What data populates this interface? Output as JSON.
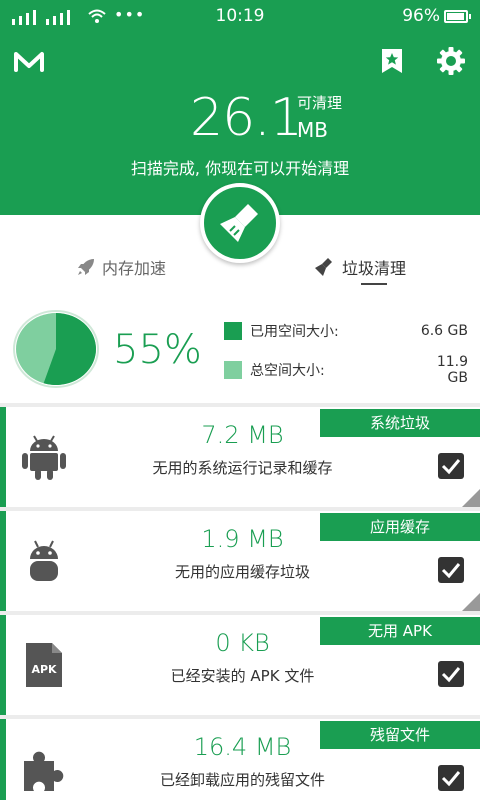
{
  "status_bar": {
    "time": "10:19",
    "battery": "96%",
    "dots": "•••"
  },
  "header": {
    "clean_size_value": "26.1",
    "clean_size_caption": "可清理",
    "clean_size_unit": "MB",
    "scan_message": "扫描完成, 你现在可以开始清理"
  },
  "tabs": [
    {
      "label": "内存加速",
      "icon": "rocket-icon",
      "selected": false
    },
    {
      "label": "垃圾清理",
      "icon": "broom-icon",
      "selected": true
    }
  ],
  "storage": {
    "used_percent_label": "55%",
    "used_fraction": 0.55,
    "used_label": "已用空间大小:",
    "used_value": "6.6 GB",
    "total_label": "总空间大小:",
    "total_value": "11.9 GB"
  },
  "items": [
    {
      "tag": "系统垃圾",
      "size": "7.2 MB",
      "desc": "无用的系统运行记录和缓存",
      "icon": "android-icon",
      "checked": true
    },
    {
      "tag": "应用缓存",
      "size": "1.9 MB",
      "desc": "无用的应用缓存垃圾",
      "icon": "android-head-icon",
      "checked": true
    },
    {
      "tag": "无用 APK",
      "size": "0 KB",
      "desc": "已经安装的 APK 文件",
      "icon": "apk-file-icon",
      "icon_text": "APK",
      "checked": true
    },
    {
      "tag": "残留文件",
      "size": "16.4 MB",
      "desc": "已经卸载应用的残留文件",
      "icon": "puzzle-icon",
      "checked": true
    }
  ],
  "colors": {
    "brand": "#1a9e52",
    "brand_light": "#7fcf9f",
    "text": "#333333"
  }
}
